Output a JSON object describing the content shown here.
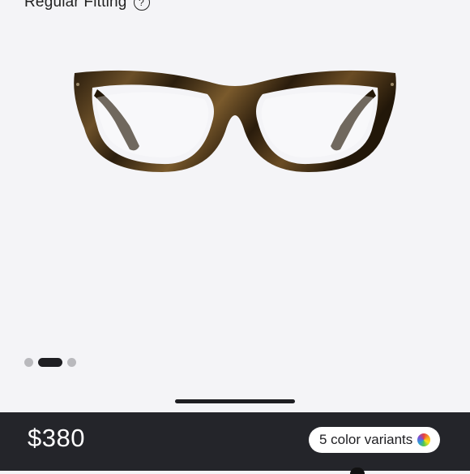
{
  "product": {
    "fitting_label": "Regular Fitting",
    "help_glyph": "?",
    "image_icon": "eyeglasses-frame",
    "frame_color": "#3a2a12"
  },
  "gallery": {
    "total_images": 3,
    "current_index": 2
  },
  "footer": {
    "price": "$380",
    "variants_label": "5 color variants",
    "variants_icon": "color-wheel-icon"
  },
  "colors": {
    "background": "#f4f4f7",
    "bottom_bar": "#24252a",
    "accent": "#1e1e22"
  }
}
